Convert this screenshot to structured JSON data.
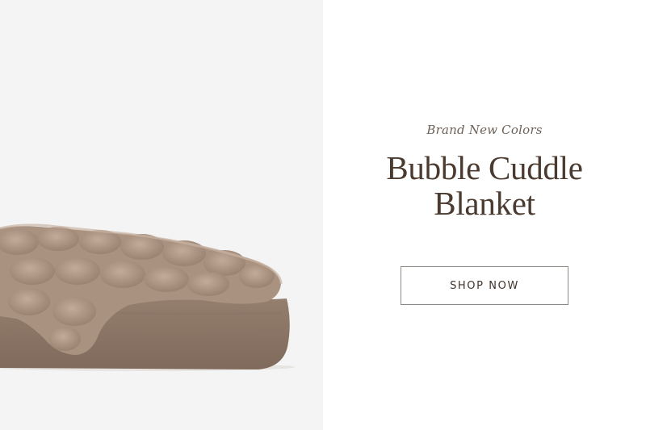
{
  "promo": {
    "eyebrow": "Brand New Colors",
    "title_line1": "Bubble Cuddle",
    "title_line2": "Blanket",
    "cta_label": "SHOP NOW"
  },
  "colors": {
    "title": "#4b3a2f",
    "blanket": "#a58d7c",
    "image_bg": "#f4f4f4"
  },
  "image": {
    "subject": "folded-faux-fur-blanket"
  }
}
